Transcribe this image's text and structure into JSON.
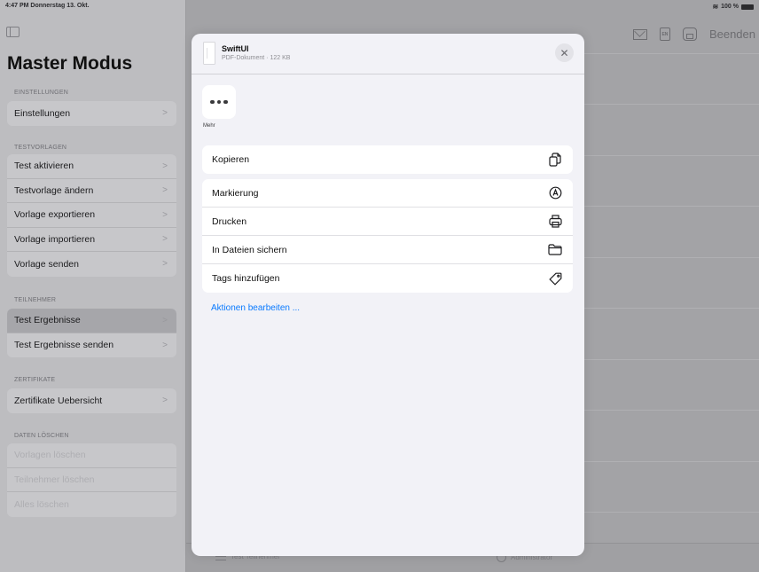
{
  "status_bar": {
    "time_date": "4:47 PM  Donnerstag 13. Okt.",
    "battery": "100 %"
  },
  "sidebar": {
    "title": "Master Modus",
    "sections": [
      {
        "header": "EINSTELLUNGEN",
        "items": [
          {
            "label": "Einstellungen",
            "chevron": true
          }
        ]
      },
      {
        "header": "TESTVORLAGEN",
        "items": [
          {
            "label": "Test aktivieren",
            "chevron": true
          },
          {
            "label": "Testvorlage ändern",
            "chevron": true
          },
          {
            "label": "Vorlage exportieren",
            "chevron": true
          },
          {
            "label": "Vorlage importieren",
            "chevron": true
          },
          {
            "label": "Vorlage senden",
            "chevron": true
          }
        ]
      },
      {
        "header": "TEILNEHMER",
        "items": [
          {
            "label": "Test Ergebnisse",
            "chevron": true,
            "selected": true
          },
          {
            "label": "Test Ergebnisse senden",
            "chevron": true
          }
        ]
      },
      {
        "header": "ZERTIFIKATE",
        "items": [
          {
            "label": "Zertifikate Uebersicht",
            "chevron": true
          }
        ]
      },
      {
        "header": "DATEN LÖSCHEN",
        "items": [
          {
            "label": "Vorlagen löschen",
            "disabled": true
          },
          {
            "label": "Teilnehmer löschen",
            "disabled": true
          },
          {
            "label": "Alles löschen",
            "disabled": true
          }
        ]
      }
    ],
    "chevron_glyph": ">"
  },
  "toolbar": {
    "beenden_label": "Beenden",
    "doc_icon_text": "EN"
  },
  "tabbar": {
    "tabs": [
      "Test Teilnehmer",
      "Administrator"
    ]
  },
  "share_sheet": {
    "file_name": "SwiftUI",
    "file_meta": "PDF-Dokument · 122 KB",
    "close_glyph": "✕",
    "more_label": "Mehr",
    "actions_top": [
      {
        "label": "Kopieren",
        "icon": "copy-icon"
      }
    ],
    "actions": [
      {
        "label": "Markierung",
        "icon": "markup-icon"
      },
      {
        "label": "Drucken",
        "icon": "print-icon"
      },
      {
        "label": "In Dateien sichern",
        "icon": "folder-icon"
      },
      {
        "label": "Tags hinzufügen",
        "icon": "tag-icon"
      }
    ],
    "edit_actions_label": "Aktionen bearbeiten ...",
    "link_color": "#0A7AFF"
  }
}
